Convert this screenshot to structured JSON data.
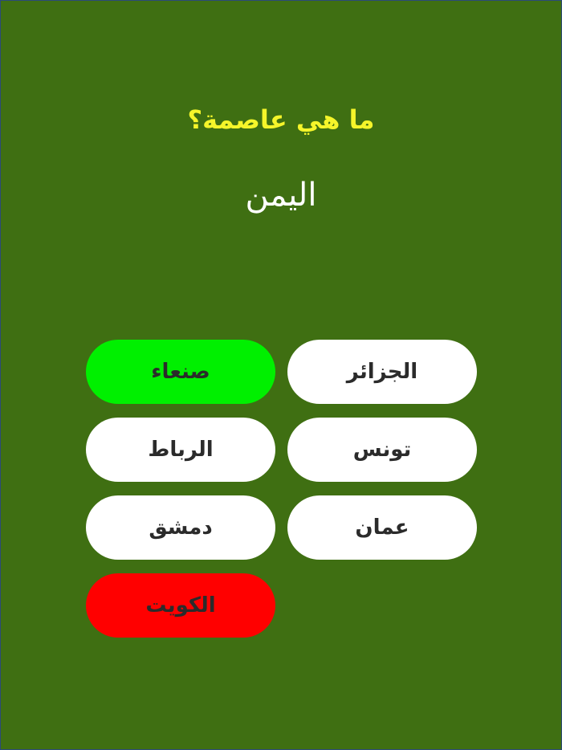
{
  "quiz": {
    "question": "ما هي عاصمة؟",
    "country": "اليمن"
  },
  "answers": [
    {
      "label": "الجزائر",
      "state": "default"
    },
    {
      "label": "صنعاء",
      "state": "correct"
    },
    {
      "label": "تونس",
      "state": "default"
    },
    {
      "label": "الرباط",
      "state": "default"
    },
    {
      "label": "عمان",
      "state": "default"
    },
    {
      "label": "دمشق",
      "state": "default"
    },
    {
      "label": "الكويت",
      "state": "wrong"
    }
  ],
  "colors": {
    "background": "#3f6f12",
    "question": "#f5f52a",
    "country": "#ffffff",
    "button_default": "#ffffff",
    "button_correct": "#00f000",
    "button_wrong": "#ff0000",
    "button_text": "#2b2b2b"
  }
}
